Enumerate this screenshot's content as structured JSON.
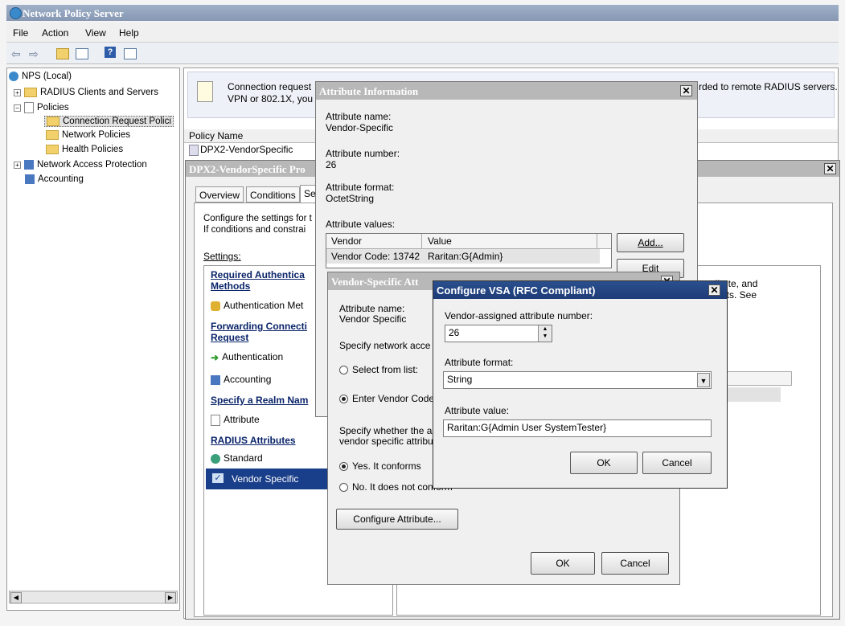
{
  "window": {
    "title": "Network Policy Server"
  },
  "menu": [
    "File",
    "Action",
    "View",
    "Help"
  ],
  "tree": {
    "root": "NPS (Local)",
    "radius_clients": "RADIUS Clients and Servers",
    "policies": "Policies",
    "connection_request": "Connection Request Polici",
    "network_policies": "Network Policies",
    "health_policies": "Health Policies",
    "nap": "Network Access Protection",
    "accounting": "Accounting"
  },
  "main": {
    "info_text1": "Connection request",
    "info_text2": "VPN or 802.1X, you",
    "info_text_right": "rded to remote RADIUS servers.",
    "list_header": "Policy Name",
    "policy_name": "DPX2-VendorSpecific"
  },
  "props": {
    "title": "DPX2-VendorSpecific Pro",
    "tabs": [
      "Overview",
      "Conditions",
      "Se"
    ],
    "desc1": "Configure the settings for t",
    "desc2": "If conditions and constrai",
    "settings_label": "Settings:",
    "right_text1": "ttribute, and",
    "right_text2": "clients. See",
    "sections": {
      "required_auth": "Required Authentica",
      "methods": "Methods",
      "auth_methods": "Authentication Met",
      "forwarding": "Forwarding Connecti",
      "request": "Request",
      "authentication": "Authentication",
      "accounting": "Accounting",
      "realm": "Specify a Realm Nam",
      "attribute": "Attribute",
      "radius_attr": "RADIUS Attributes",
      "standard": "Standard",
      "vendor_specific": "Vendor Specific"
    }
  },
  "attr_info": {
    "title": "Attribute Information",
    "name_label": "Attribute name:",
    "name_value": "Vendor-Specific",
    "number_label": "Attribute number:",
    "number_value": "26",
    "format_label": "Attribute format:",
    "format_value": "OctetString",
    "values_label": "Attribute values:",
    "col_vendor": "Vendor",
    "col_value": "Value",
    "row_vendor": "Vendor Code: 13742",
    "row_value": "Raritan:G{Admin}",
    "add_button": "Add...",
    "edit_button": "Edit"
  },
  "vsa_info": {
    "title": "Vendor-Specific Att",
    "name_label": "Attribute name:",
    "name_value": "Vendor Specific",
    "specify_network": "Specify network acce",
    "select_from_list": "Select from list:",
    "enter_vendor_code": "Enter Vendor Code",
    "specify_whether1": "Specify whether the a",
    "specify_whether2": "vendor specific attribu",
    "yes_conforms": "Yes. It conforms",
    "no_conforms": "No. It does not conform",
    "configure_button": "Configure Attribute...",
    "ok": "OK",
    "cancel": "Cancel"
  },
  "vsa_config": {
    "title": "Configure VSA (RFC Compliant)",
    "number_label": "Vendor-assigned attribute number:",
    "number_value": "26",
    "format_label": "Attribute format:",
    "format_value": "String",
    "value_label": "Attribute value:",
    "value_value": "Raritan:G{Admin User SystemTester}",
    "ok": "OK",
    "cancel": "Cancel"
  }
}
